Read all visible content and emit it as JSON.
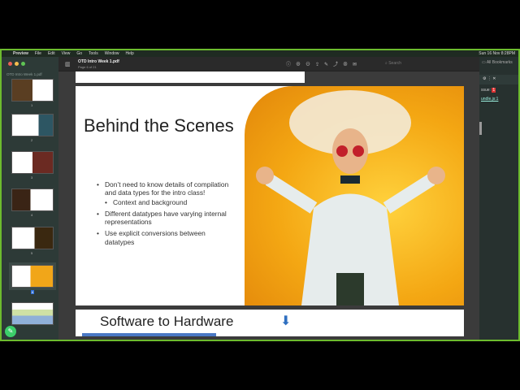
{
  "menubar": {
    "app": "Preview",
    "items": [
      "File",
      "Edit",
      "View",
      "Go",
      "Tools",
      "Window",
      "Help"
    ],
    "clock": "Sun 16 Nov 8:28PM"
  },
  "window": {
    "title": "OTD Intro Week 1.pdf",
    "subtitle": "Page 6 of 21",
    "search_placeholder": "Search"
  },
  "sidebar": {
    "title": "OTD Intro Week 1.pdf",
    "pages": [
      "1",
      "2",
      "3",
      "4",
      "5",
      "6",
      "7"
    ],
    "selected": "6"
  },
  "slide": {
    "title": "Behind the Scenes",
    "bullets": [
      {
        "text": "Don’t need to know details of compilation and data types for the intro class!",
        "level": 1
      },
      {
        "text": "Context and background",
        "level": 2
      },
      {
        "text": "Different datatypes have varying internal representations",
        "level": 1
      },
      {
        "text": "Use explicit conversions between datatypes",
        "level": 1
      }
    ]
  },
  "next_slide": {
    "title": "Software to Hardware"
  },
  "devtools": {
    "bookmarks": "All Bookmarks",
    "issues_label": "ssue:",
    "issues_count": "1",
    "source_link": "undle.js:1"
  },
  "colors": {
    "frame": "#6dbb2e",
    "accent": "#f4a713"
  }
}
